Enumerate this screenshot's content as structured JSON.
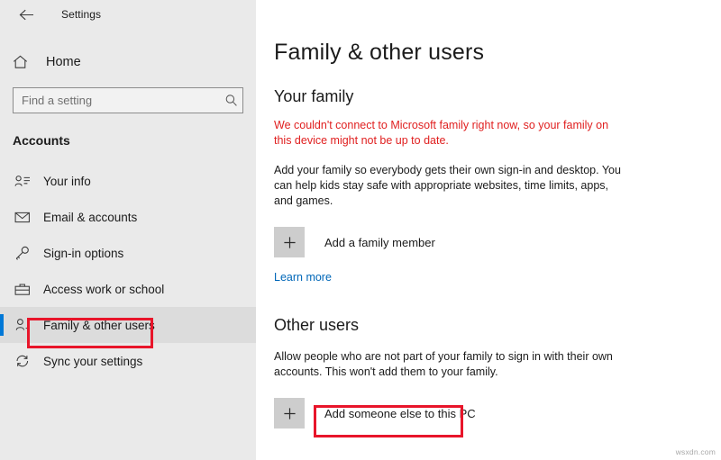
{
  "window": {
    "app_title": "Settings",
    "back_icon": "back-arrow-icon"
  },
  "sidebar": {
    "home": {
      "label": "Home",
      "icon": "home-icon"
    },
    "search": {
      "placeholder": "Find a setting",
      "value": "",
      "icon": "search-icon"
    },
    "category": "Accounts",
    "items": [
      {
        "label": "Your info",
        "icon": "user-info-icon",
        "selected": false
      },
      {
        "label": "Email & accounts",
        "icon": "envelope-icon",
        "selected": false
      },
      {
        "label": "Sign-in options",
        "icon": "key-icon",
        "selected": false
      },
      {
        "label": "Access work or school",
        "icon": "briefcase-icon",
        "selected": false
      },
      {
        "label": "Family & other users",
        "icon": "user-add-icon",
        "selected": true
      },
      {
        "label": "Sync your settings",
        "icon": "sync-icon",
        "selected": false
      }
    ]
  },
  "main": {
    "page_title": "Family & other users",
    "your_family": {
      "heading": "Your family",
      "error": "We couldn't connect to Microsoft family right now, so your family on this device might not be up to date.",
      "description": "Add your family so everybody gets their own sign-in and desktop. You can help kids stay safe with appropriate websites, time limits, apps, and games.",
      "add_button_label": "Add a family member",
      "add_button_icon": "plus-icon",
      "learn_more_label": "Learn more"
    },
    "other_users": {
      "heading": "Other users",
      "description": "Allow people who are not part of your family to sign in with their own accounts. This won't add them to your family.",
      "add_button_label": "Add someone else to this PC",
      "add_button_icon": "plus-icon"
    }
  },
  "annotations": {
    "color": "#e8152a",
    "highlight_sidebar_item": "Family & other users",
    "highlight_button": "Add someone else to this PC"
  },
  "watermark": "wsxdn.com",
  "colors": {
    "sidebar_bg": "#eaeaea",
    "selected_bg": "#dcdcdc",
    "accent": "#0078d7",
    "link": "#0067b8",
    "error": "#e02020",
    "plus_box": "#cdcdcd"
  }
}
